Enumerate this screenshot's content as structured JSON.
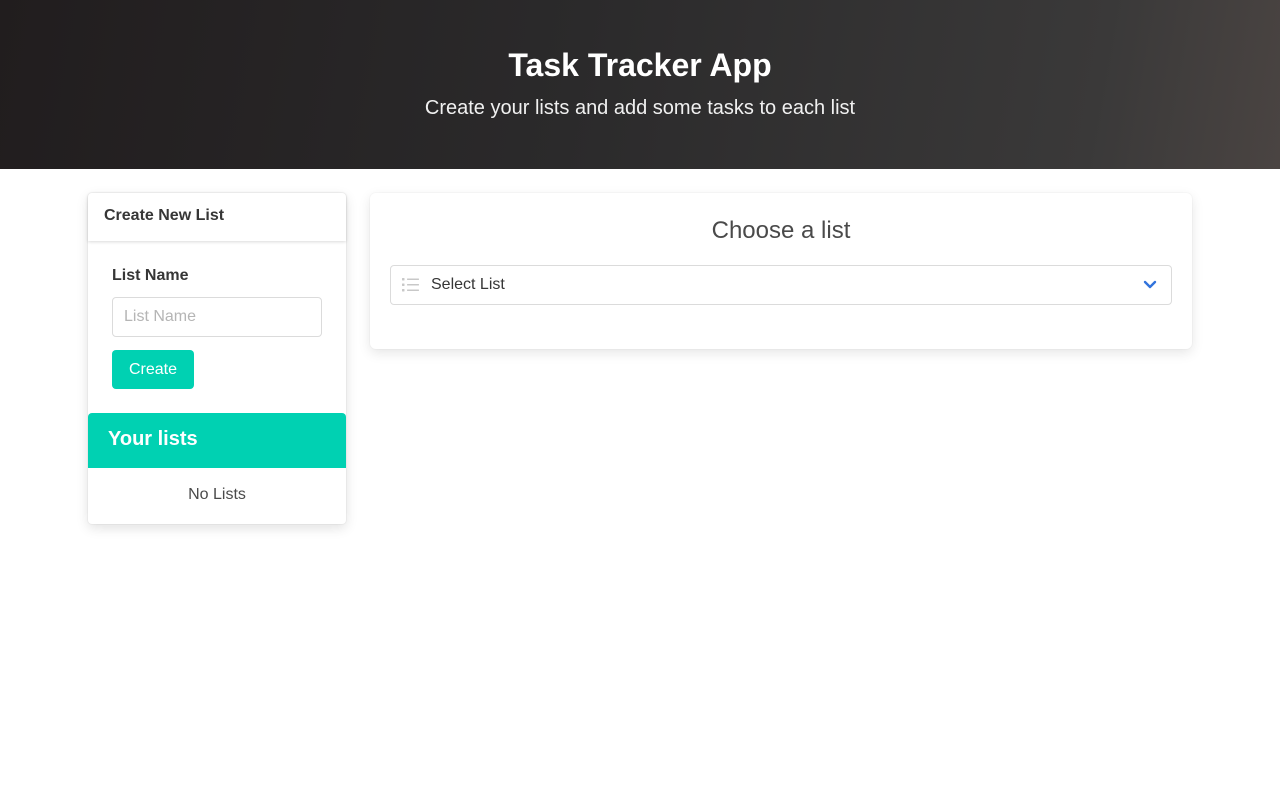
{
  "hero": {
    "title": "Task Tracker App",
    "subtitle": "Create your lists and add some tasks to each list"
  },
  "sidebar": {
    "create_card_title": "Create New List",
    "field_label": "List Name",
    "input_placeholder": "List Name",
    "input_value": "",
    "create_button_label": "Create",
    "lists_title": "Your lists",
    "empty_text": "No Lists"
  },
  "main": {
    "title": "Choose a list",
    "select": {
      "icon": "list-icon",
      "selected_value": "Select List",
      "dropdown_icon": "chevron-down-icon"
    }
  },
  "colors": {
    "accent": "#00d1b2",
    "hero_dark": "#211d1e",
    "link_blue": "#3273dc"
  }
}
